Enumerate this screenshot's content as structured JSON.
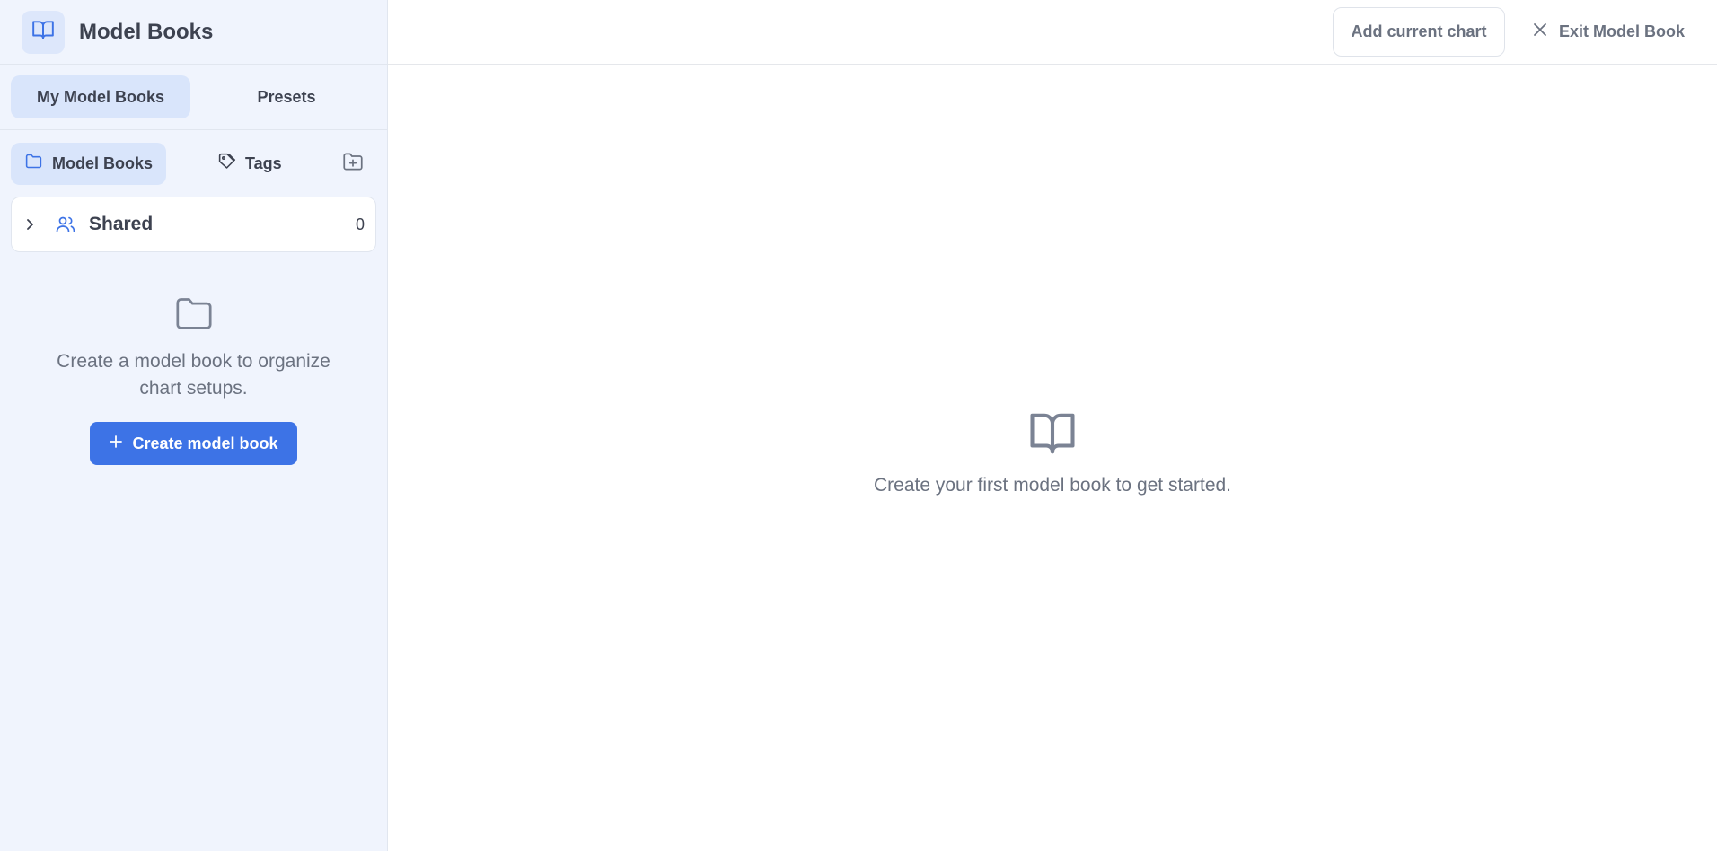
{
  "app": {
    "title": "Model Books"
  },
  "mode_tabs": [
    {
      "label": "My Model Books",
      "active": true
    },
    {
      "label": "Presets",
      "active": false
    }
  ],
  "view_tabs": [
    {
      "label": "Model Books",
      "icon": "folder-icon",
      "active": true
    },
    {
      "label": "Tags",
      "icon": "tag-icon",
      "active": false
    }
  ],
  "new_folder": {
    "icon": "folder-plus-icon"
  },
  "shared": {
    "label": "Shared",
    "count": "0",
    "icon": "users-icon"
  },
  "sidebar_empty": {
    "message": "Create a model book to organize chart setups.",
    "button_label": "Create model book",
    "button_icon": "plus-icon"
  },
  "topbar": {
    "add_chart_label": "Add current chart",
    "exit_label": "Exit Model Book",
    "exit_icon": "close-icon"
  },
  "main_empty": {
    "message": "Create your first model book to get started.",
    "icon": "open-book-icon"
  },
  "colors": {
    "accent": "#3d73e6",
    "sidebar_bg": "#f0f4fd",
    "active_tab_bg": "#d9e5fb",
    "muted_text": "#6b7280"
  }
}
